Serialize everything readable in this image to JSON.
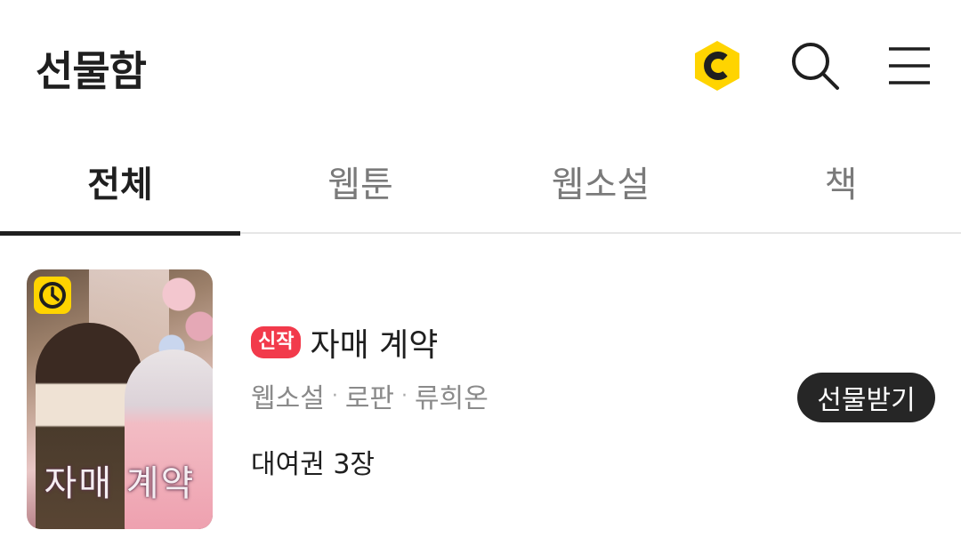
{
  "header": {
    "title": "선물함",
    "coin_icon": "cash-coin-icon",
    "search_icon": "search-icon",
    "menu_icon": "hamburger-menu-icon",
    "accent_color": "#ffd400"
  },
  "tabs": [
    {
      "label": "전체",
      "active": true
    },
    {
      "label": "웹툰",
      "active": false
    },
    {
      "label": "웹소설",
      "active": false
    },
    {
      "label": "책",
      "active": false
    }
  ],
  "gift_items": [
    {
      "badge": "신작",
      "badge_color": "#f23a4b",
      "title": "자매 계약",
      "category": "웹소설",
      "genre": "로판",
      "author": "류희온",
      "separator": "·",
      "rental": "대여권 3장",
      "action_label": "선물받기",
      "cover_title": "자매 계약",
      "cover_icon": "clock-icon"
    }
  ]
}
